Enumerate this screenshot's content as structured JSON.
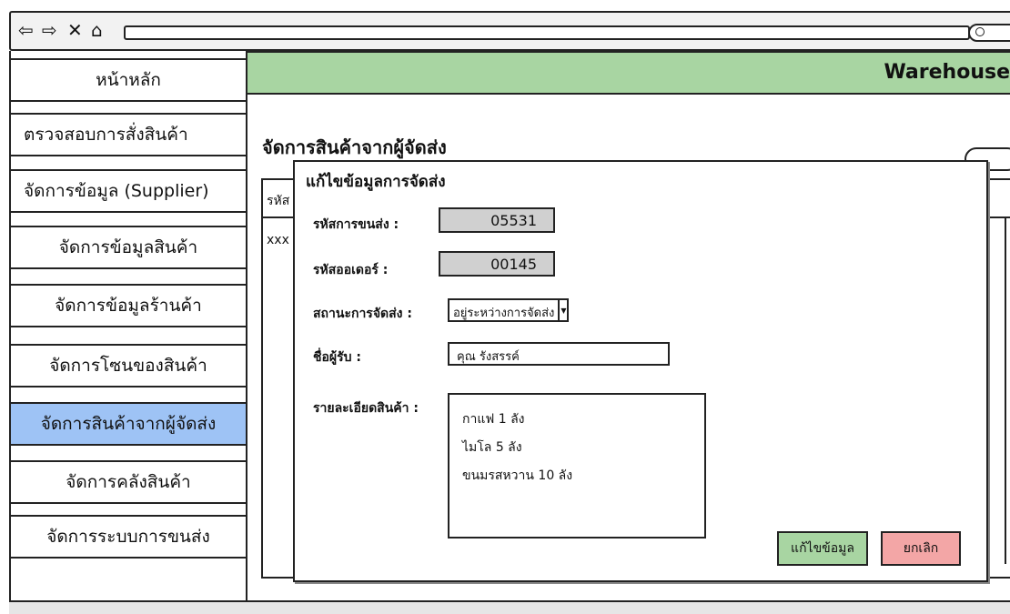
{
  "browser": {
    "back_icon": "back-arrow-icon",
    "forward_icon": "forward-arrow-icon",
    "close_icon": "close-icon",
    "home_icon": "home-icon"
  },
  "sidebar": {
    "items": [
      {
        "label": "หน้าหลัก",
        "active": false
      },
      {
        "label": "ตรวจสอบการสั่งสินค้า",
        "active": false
      },
      {
        "label": "จัดการข้อมูล (Supplier)",
        "active": false
      },
      {
        "label": "จัดการข้อมูลสินค้า",
        "active": false
      },
      {
        "label": "จัดการข้อมูลร้านค้า",
        "active": false
      },
      {
        "label": "จัดการโซนของสินค้า",
        "active": false
      },
      {
        "label": "จัดการสินค้าจากผู้จัดส่ง",
        "active": true
      },
      {
        "label": "จัดการคลังสินค้า",
        "active": false
      },
      {
        "label": "จัดการระบบการขนส่ง",
        "active": false
      }
    ]
  },
  "header": {
    "title": "Warehouse"
  },
  "page": {
    "title": "จัดการสินค้าจากผู้จัดส่ง",
    "table_header_fragment": "รหัส",
    "table_row_fragment": "xxx"
  },
  "dialog": {
    "title": "แก้ไขข้อมูลการจัดส่ง",
    "shipping_id_label": "รหัสการขนส่ง :",
    "shipping_id_value": "05531",
    "order_id_label": "รหัสออเดอร์ :",
    "order_id_value": "00145",
    "status_label": "สถานะการจัดส่ง :",
    "status_value": "อยู่ระหว่างการจัดส่ง",
    "recipient_label": "ชื่อผู้รับ :",
    "recipient_value": "คุณ รังสรรค์",
    "details_label": "รายละเอียดสินค้า :",
    "details_lines": [
      "กาแฟ 1 ลัง",
      "ไมโล 5 ลัง",
      "ขนมรสหวาน 10 ลัง"
    ],
    "edit_button": "แก้ไขข้อมูล",
    "cancel_button": "ยกเลิก"
  },
  "colors": {
    "banner": "#a8d5a2",
    "active_sidebar": "#9ec3f5",
    "edit_button": "#a8d5a2",
    "cancel_button": "#f3a6a6",
    "readonly_field": "#d0d0d0"
  }
}
